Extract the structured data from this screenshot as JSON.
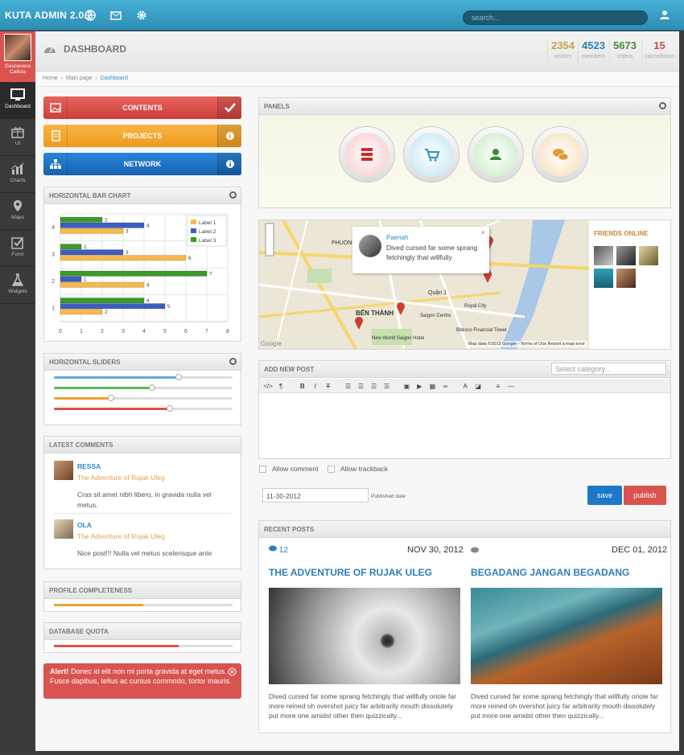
{
  "app": {
    "title": "KUTA ADMIN 2.0.2",
    "search_placeholder": "search..."
  },
  "sidebar": {
    "user": "Geunevere Calista",
    "items": [
      {
        "label": "Dashboard",
        "icon": "monitor-icon"
      },
      {
        "label": "UI",
        "icon": "gift-icon"
      },
      {
        "label": "Charts",
        "icon": "bar-chart-icon"
      },
      {
        "label": "Maps",
        "icon": "map-marker-icon"
      },
      {
        "label": "Form",
        "icon": "checkbox-icon"
      },
      {
        "label": "Widgets",
        "icon": "flask-icon"
      }
    ]
  },
  "header": {
    "title": "DASHBOARD",
    "stats": [
      {
        "value": "2354",
        "label": "visitors",
        "color": "#c9a04d"
      },
      {
        "value": "4523",
        "label": "members",
        "color": "#2e7eb8"
      },
      {
        "value": "5673",
        "label": "orders",
        "color": "#4a8a3a"
      },
      {
        "value": "15",
        "label": "cancellation",
        "color": "#c0504d"
      }
    ]
  },
  "breadcrumb": [
    "Home",
    "Main page",
    "Dashboard"
  ],
  "buttons": [
    {
      "label": "CONTENTS",
      "color": "#d9534f"
    },
    {
      "label": "PROJECTS",
      "color": "#f0a030"
    },
    {
      "label": "NETWORK",
      "color": "#1d6fc4"
    }
  ],
  "bar_panel": {
    "title": "HORIZONTAL BAR CHART"
  },
  "chart_data": {
    "type": "bar",
    "orientation": "horizontal",
    "categories": [
      "4",
      "3",
      "2",
      "1"
    ],
    "series": [
      {
        "name": "Label 1",
        "color": "#f6b94a",
        "values": [
          3,
          6,
          4,
          2
        ]
      },
      {
        "name": "Label 2",
        "color": "#3d5ec0",
        "values": [
          4,
          3,
          1,
          5
        ]
      },
      {
        "name": "Label 3",
        "color": "#3a9a2a",
        "values": [
          2,
          1,
          7,
          4
        ]
      }
    ],
    "xlim": [
      0,
      8
    ],
    "xticks": [
      "0",
      "1",
      "2",
      "3",
      "4",
      "5",
      "6",
      "7",
      "8"
    ],
    "legend": "top-right",
    "grid": true
  },
  "sliders_panel": {
    "title": "HORIZONTAL SLIDERS",
    "values": [
      0.7,
      0.55,
      0.32,
      0.65
    ],
    "colors": [
      "#5bb0dd",
      "#5cb85c",
      "#f0a030",
      "#d9534f"
    ]
  },
  "comments_panel": {
    "title": "LATEST COMMENTS",
    "items": [
      {
        "name": "RESSA",
        "title": "The Adventure of Rujak Uleg",
        "text": "Cras sit amet nibh libero, in gravida nulla vel metus."
      },
      {
        "name": "OLA",
        "title": "The Adventure of Rujak Uleg",
        "text": "Nice post!!! Nulla vel metus scelerisque ante"
      }
    ]
  },
  "profile_panel": {
    "title": "PROFILE COMPLETENESS",
    "value": 0.5
  },
  "quota_panel": {
    "title": "DATABASE QUOTA",
    "value": 0.7
  },
  "alert": {
    "title": "Alert!",
    "text": "Donec id elit non mi porta gravida at eget metus. Fusce dapibus, tellus ac cursus commodo, tortor mauris."
  },
  "panels": {
    "title": "PANELS",
    "icons": [
      "server-icon",
      "cart-icon",
      "user-icon",
      "chat-icon"
    ]
  },
  "map": {
    "popup_name": "Paenah",
    "popup_text": "Dived cursed far some sprang fetchingly that willfully",
    "friends_title": "FRIENDS ONLINE",
    "attribution": "Map data ©2013 Google - Terms of Use  Report a map error",
    "labels": [
      "BẾN THÀNH",
      "PHUONG",
      "Quận 1",
      "Saigon Centre",
      "Royal City",
      "New World Saigon Hotel",
      "Bitexco Financial Tower",
      "Google"
    ]
  },
  "post_form": {
    "title": "ADD NEW POST",
    "category_placeholder": "Select category...",
    "allow_comment": "Allow comment",
    "allow_trackback": "Allow trackback",
    "date": "11-30-2012",
    "date_label": "Published date",
    "save": "save",
    "publish": "publish"
  },
  "recent": {
    "title": "RECENT POSTS",
    "posts": [
      {
        "comments": "12",
        "date": "NOV 30, 2012",
        "title": "THE ADVENTURE OF RUJAK ULEG",
        "text": "Dived cursed far some sprang fetchingly that willfully oriole far more reined oh overshot juicy far arbitrarily mouth dissolutely put more one amidst other then quizzically..."
      },
      {
        "comments": "",
        "date": "DEC 01, 2012",
        "title": "BEGADANG JANGAN BEGADANG",
        "text": "Dived cursed far some sprang fetchingly that willfully oriole far more reined oh overshot juicy far arbitrarily mouth dissolutely put more one amidst other then quizzically..."
      }
    ]
  }
}
